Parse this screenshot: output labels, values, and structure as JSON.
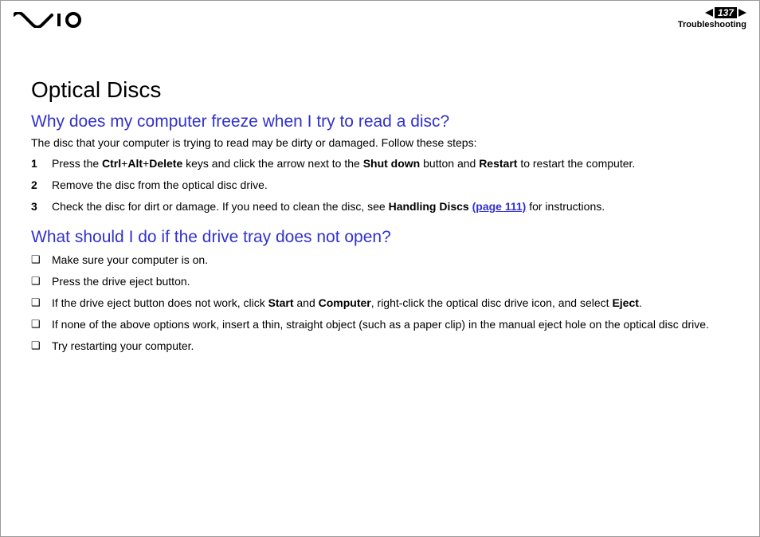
{
  "header": {
    "page_number": "137",
    "section": "Troubleshooting"
  },
  "content": {
    "title": "Optical Discs",
    "q1": {
      "heading": "Why does my computer freeze when I try to read a disc?",
      "intro": "The disc that your computer is trying to read may be dirty or damaged. Follow these steps:",
      "steps": [
        {
          "n": "1",
          "pre": "Press the ",
          "b1": "Ctrl",
          "plus1": "+",
          "b2": "Alt",
          "plus2": "+",
          "b3": "Delete",
          "mid1": " keys and click the arrow next to the ",
          "b4": "Shut down",
          "mid2": " button and ",
          "b5": "Restart",
          "post": " to restart the computer."
        },
        {
          "n": "2",
          "text": "Remove the disc from the optical disc drive."
        },
        {
          "n": "3",
          "pre": "Check the disc for dirt or damage. If you need to clean the disc, see ",
          "b1": "Handling Discs",
          "sp": " ",
          "link": "(page 111)",
          "post": " for instructions."
        }
      ]
    },
    "q2": {
      "heading": "What should I do if the drive tray does not open?",
      "bullets": [
        {
          "text": "Make sure your computer is on."
        },
        {
          "text": "Press the drive eject button."
        },
        {
          "pre": "If the drive eject button does not work, click ",
          "b1": "Start",
          "mid1": " and ",
          "b2": "Computer",
          "mid2": ", right-click the optical disc drive icon, and select ",
          "b3": "Eject",
          "post": "."
        },
        {
          "text": "If none of the above options work, insert a thin, straight object (such as a paper clip) in the manual eject hole on the optical disc drive."
        },
        {
          "text": "Try restarting your computer."
        }
      ]
    }
  }
}
